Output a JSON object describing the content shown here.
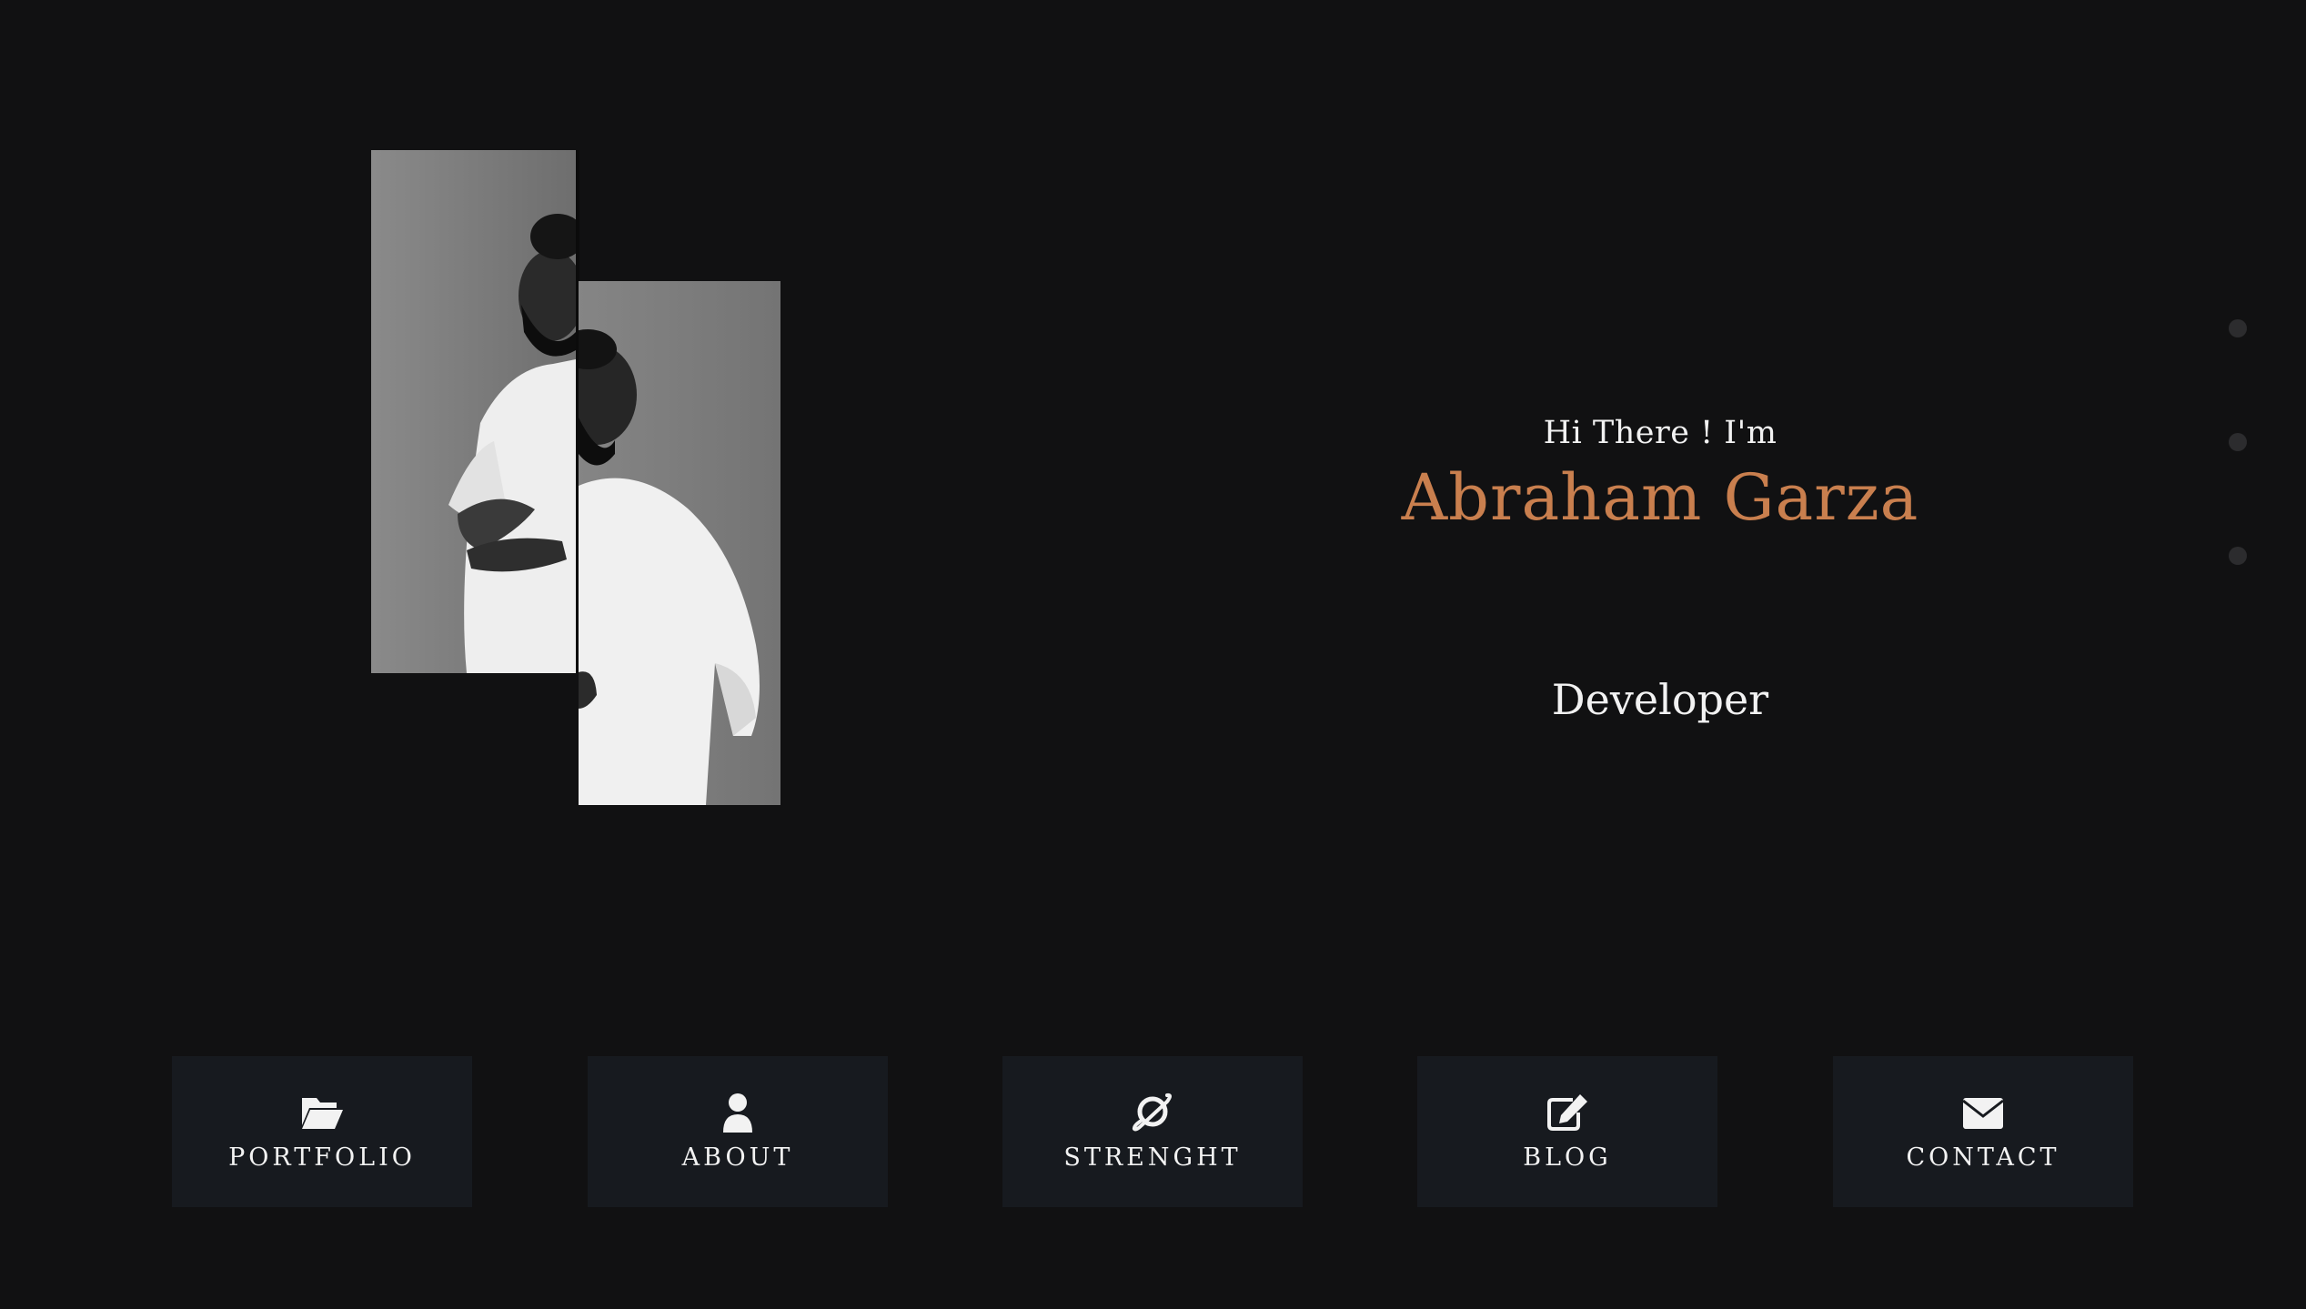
{
  "hero": {
    "greeting": "Hi There ! I'm",
    "name": "Abraham Garza",
    "role": "Developer"
  },
  "nav": [
    {
      "label": "PORTFOLIO",
      "icon": "folder-open-icon"
    },
    {
      "label": "ABOUT",
      "icon": "user-icon"
    },
    {
      "label": "STRENGHT",
      "icon": "planet-ring-icon"
    },
    {
      "label": "BLOG",
      "icon": "edit-icon"
    },
    {
      "label": "CONTACT",
      "icon": "envelope-icon"
    }
  ],
  "colors": {
    "background": "#111112",
    "accent": "#c97f4e",
    "tile": "#171a1f",
    "text": "#f2f2f2",
    "dot": "#2c2c2e"
  }
}
